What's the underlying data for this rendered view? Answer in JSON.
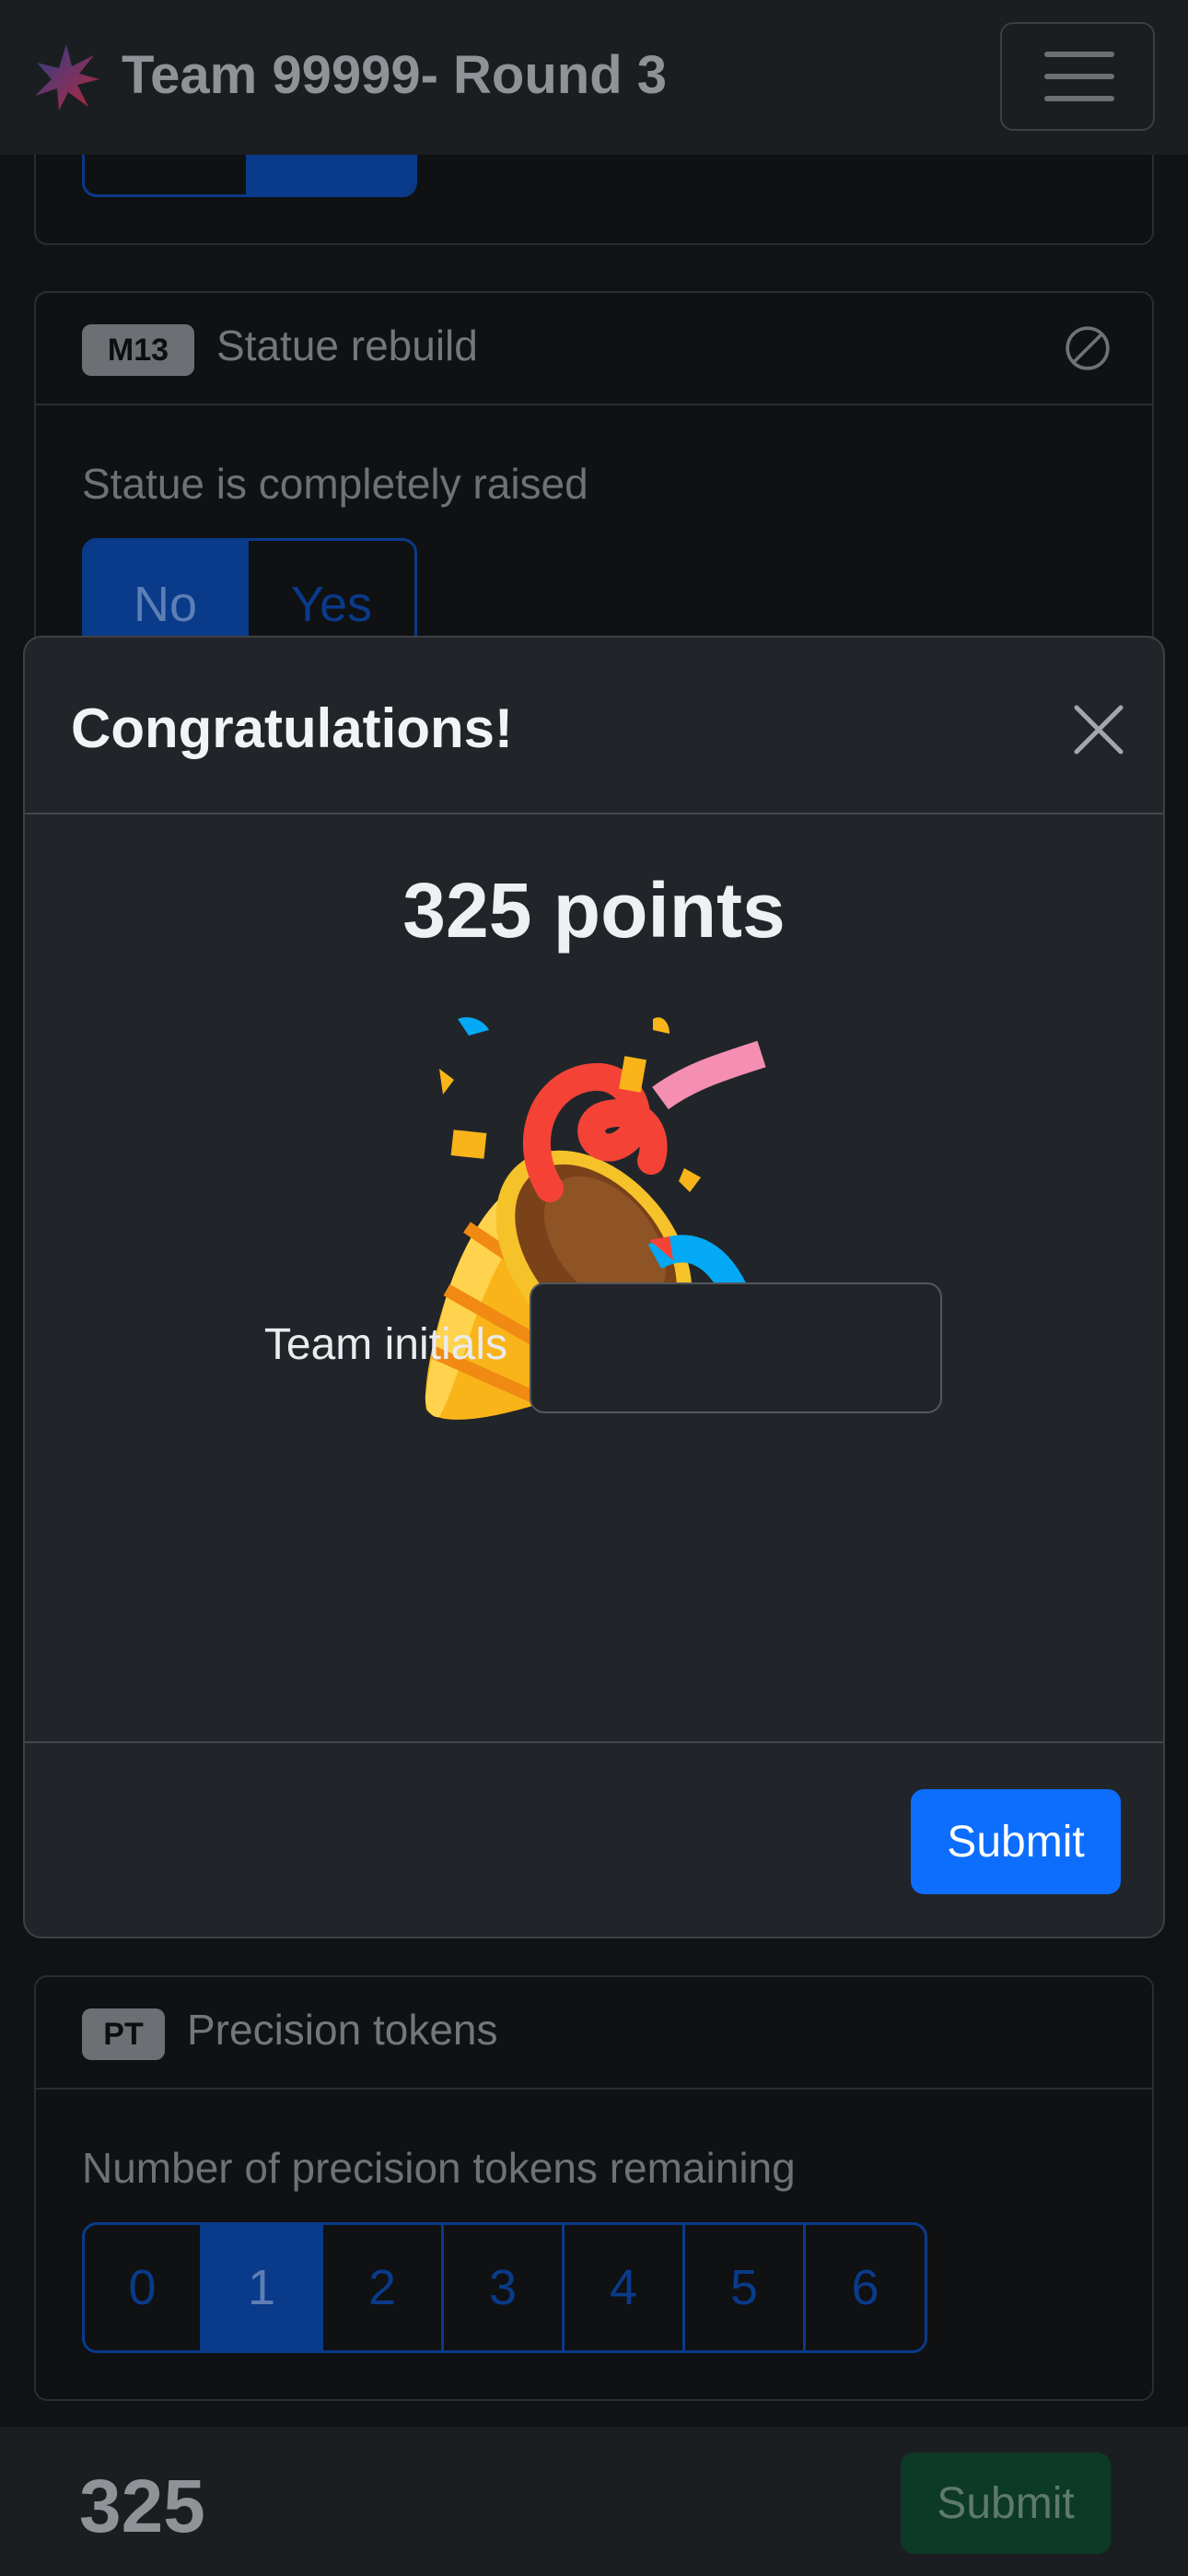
{
  "navbar": {
    "title": "Team 99999- Round 3",
    "logo_icon": "star-burst-logo-icon",
    "menu_icon": "hamburger-menu-icon"
  },
  "missions": [
    {
      "badge": "M13",
      "title": "Statue rebuild",
      "status_icon": "slash-circle-icon",
      "question": "Statue is completely raised",
      "options": [
        "No",
        "Yes"
      ],
      "selected": "No"
    },
    {
      "badge": "PT",
      "title": "Precision tokens",
      "question": "Number of precision tokens remaining",
      "options": [
        "0",
        "1",
        "2",
        "3",
        "4",
        "5",
        "6"
      ],
      "selected": "1"
    }
  ],
  "modal": {
    "title": "Congratulations!",
    "close_icon": "close-x-icon",
    "points_text": "325 points",
    "celebration_icon": "party-popper-icon",
    "initials_label": "Team initials",
    "initials_value": "",
    "submit_label": "Submit"
  },
  "footer": {
    "score": "325",
    "submit_label": "Submit"
  },
  "colors": {
    "primary": "#0d6efd",
    "success_dark": "#0d3a26",
    "modal_bg": "#212529",
    "page_bg": "#101214"
  }
}
